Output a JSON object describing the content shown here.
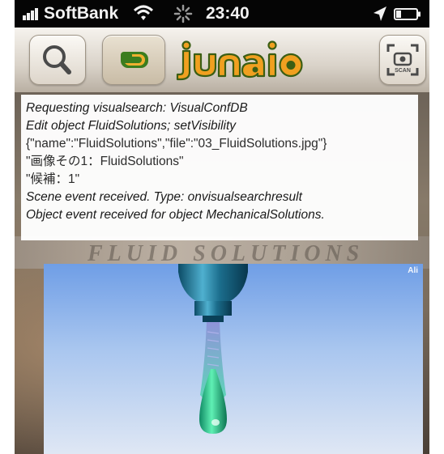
{
  "status_bar": {
    "carrier": "SoftBank",
    "time": "23:40",
    "icons": [
      "signal-bars",
      "wifi-icon",
      "activity-icon",
      "location-icon",
      "battery-icon"
    ]
  },
  "toolbar": {
    "buttons": [
      "search-icon",
      "junaio-channel-icon",
      "scan-icon"
    ],
    "brand": "junaio",
    "scan_label": "SCAN"
  },
  "log": {
    "lines": [
      "Requesting visualsearch: VisualConfDB",
      "Edit object FluidSolutions; setVisibility",
      "{\"name\":\"FluidSolutions\",\"file\":\"03_FluidSolutions.jpg\"}",
      "\"画像その1：FluidSolutions\"",
      "\"候補：1\"",
      "Scene event received. Type: onvisualsearchresult",
      "Object event received for object MechanicalSolutions."
    ]
  },
  "scene": {
    "print_text": "FLUID SOLUTIONS"
  },
  "render": {
    "tag": "Ali"
  },
  "colors": {
    "status_bar": "#050505",
    "toolbar_top": "#f6f3ee",
    "toolbar_bottom": "#b9afa2",
    "logo_orange": "#f0a020",
    "logo_green": "#3b7d1e",
    "render_sky": "#6f9ee6",
    "drop_green": "#3bd28a"
  }
}
